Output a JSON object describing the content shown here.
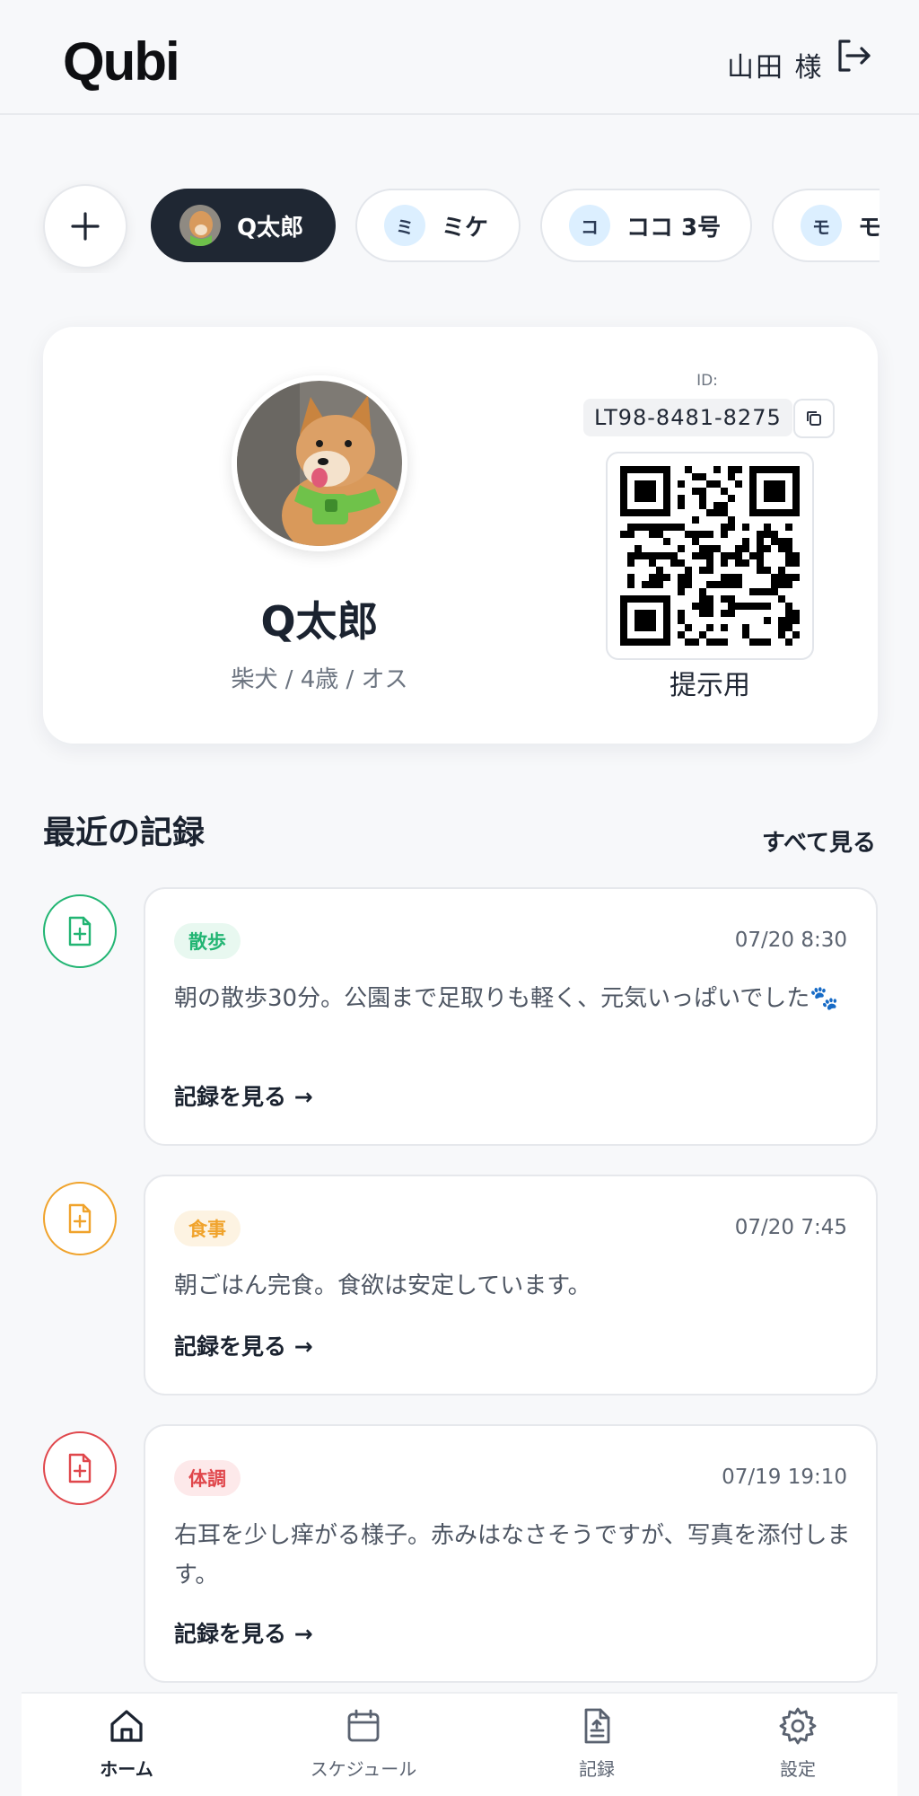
{
  "header": {
    "logo": "Qubi",
    "user_name": "山田 様",
    "logout_icon": "logout-icon"
  },
  "pets": {
    "add_icon": "plus-icon",
    "items": [
      {
        "initial": "",
        "name": "Q太郎",
        "active": true
      },
      {
        "initial": "ミ",
        "name": "ミケ"
      },
      {
        "initial": "コ",
        "name": "ココ 3号"
      },
      {
        "initial": "モ",
        "name": "モモ"
      }
    ]
  },
  "profile": {
    "name": "Q太郎",
    "meta": "柴犬 / 4歳 / オス",
    "id_label": "ID:",
    "id_value": "LT98-8481-8275",
    "qr_caption": "提示用"
  },
  "records": {
    "title": "最近の記録",
    "see_all": "すべて見る",
    "items": [
      {
        "category": "散歩",
        "time": "07/20 8:30",
        "text": "朝の散歩30分。公園まで足取りも軽く、元気いっぱいでした🐾",
        "link": "記録を見る →",
        "color": "#22b573",
        "bg": "#e8f8f0"
      },
      {
        "category": "食事",
        "time": "07/20 7:45",
        "text": "朝ごはん完食。食欲は安定しています。",
        "link": "記録を見る →",
        "color": "#f0a32c",
        "bg": "#fdf3e2"
      },
      {
        "category": "体調",
        "time": "07/19 19:10",
        "text": "右耳を少し痒がる様子。赤みはなさそうですが、写真を添付します。",
        "link": "記録を見る →",
        "color": "#e0474c",
        "bg": "#fde9ea"
      }
    ]
  },
  "nav": {
    "items": [
      {
        "label": "ホーム",
        "icon": "home-icon",
        "active": true
      },
      {
        "label": "スケジュール",
        "icon": "calendar-icon"
      },
      {
        "label": "記録",
        "icon": "document-icon"
      },
      {
        "label": "設定",
        "icon": "gear-icon"
      }
    ]
  }
}
